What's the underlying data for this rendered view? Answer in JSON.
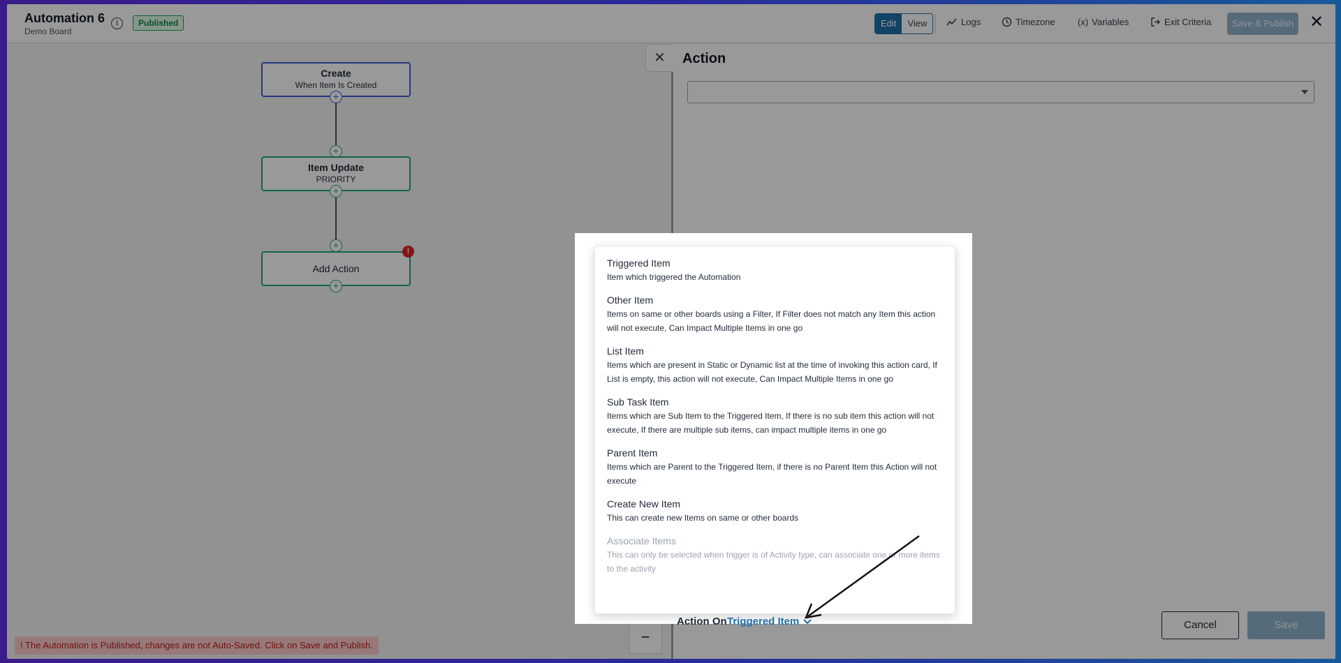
{
  "header": {
    "title": "Automation 6",
    "subtitle": "Demo Board",
    "info_icon": "info-icon",
    "status_badge": "Published",
    "edit_label": "Edit",
    "view_label": "View",
    "logs_label": "Logs",
    "timezone_label": "Timezone",
    "variables_icon": "(x)",
    "variables_label": "Variables",
    "exit_criteria_label": "Exit Criteria",
    "save_publish_label": "Save & Publish",
    "close_icon": "✕"
  },
  "flow": {
    "nodes": [
      {
        "title": "Create",
        "subtitle": "When Item Is Created"
      },
      {
        "title": "Item Update",
        "subtitle": "PRIORITY"
      },
      {
        "title": "Add Action",
        "subtitle": ""
      }
    ],
    "alert_mark": "!",
    "plus": "+",
    "zoom_out": "−"
  },
  "warning": "! The Automation is Published, changes are not Auto-Saved. Click on Save and Publish.",
  "panel": {
    "close_icon": "✕",
    "title": "Action",
    "select_value": "",
    "action_on_label": "Action On",
    "action_on_value": "Triggered Item",
    "cancel_label": "Cancel",
    "save_label": "Save"
  },
  "dropdown": {
    "options": [
      {
        "title": "Triggered Item",
        "desc": "Item which triggered the Automation",
        "disabled": false
      },
      {
        "title": "Other Item",
        "desc": "Items on same or other boards using a Filter, If Filter does not match any Item this action will not execute, Can Impact Multiple Items in one go",
        "disabled": false
      },
      {
        "title": "List Item",
        "desc": "Items which are present in Static or Dynamic list at the time of invoking this action card, If List is empty, this action will not execute, Can Impact Multiple Items in one go",
        "disabled": false
      },
      {
        "title": "Sub Task Item",
        "desc": "Items which are Sub Item to the Triggered Item, If there is no sub item this action will not execute, If there are multiple sub items, can impact multiple items in one go",
        "disabled": false
      },
      {
        "title": "Parent Item",
        "desc": "Items which are Parent to the Triggered Item, if there is no Parent Item this Action will not execute",
        "disabled": false
      },
      {
        "title": "Create New Item",
        "desc": "This can create new Items on same or other boards",
        "disabled": false
      },
      {
        "title": "Associate Items",
        "desc": "This can only be selected when trigger is of Activity type, can associate one or more items to the activity",
        "disabled": true
      }
    ]
  },
  "colors": {
    "primary": "#1e6fa8",
    "published_green": "#16a34a",
    "create_node_border": "#3b5bdb",
    "action_node_border": "#1fa97a",
    "alert_red": "#dc2626"
  }
}
